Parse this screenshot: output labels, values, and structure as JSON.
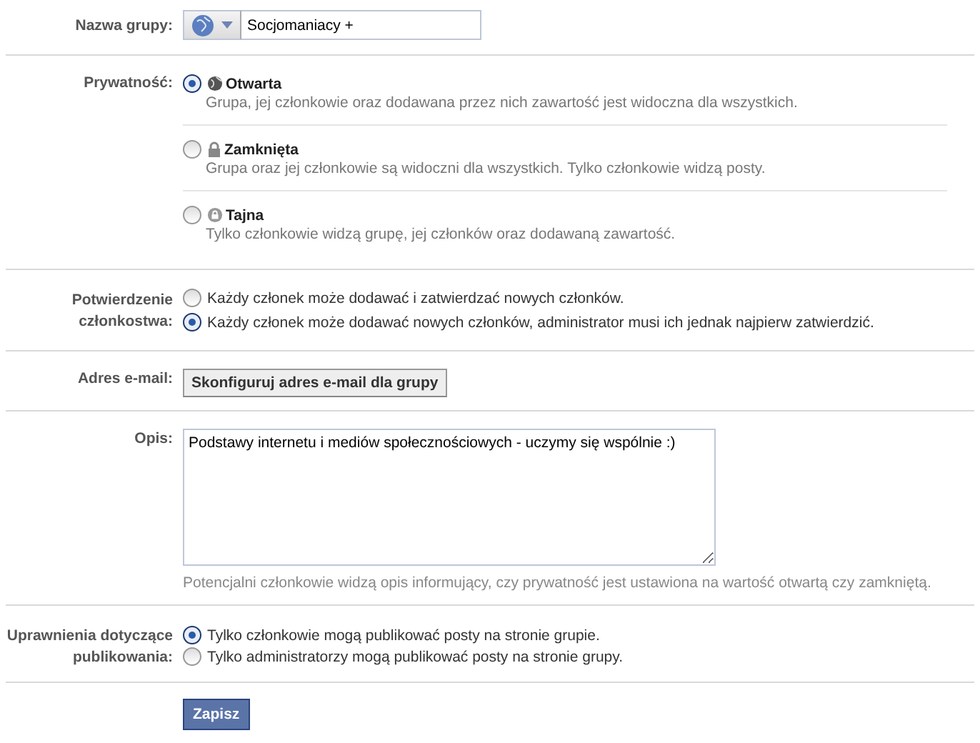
{
  "group_name": {
    "label": "Nazwa grupy:",
    "value": "Socjomaniacy +"
  },
  "privacy": {
    "label": "Prywatność:",
    "options": [
      {
        "kind": "open",
        "title": "Otwarta",
        "description": "Grupa, jej członkowie oraz dodawana przez nich zawartość jest widoczna dla wszystkich.",
        "selected": true
      },
      {
        "kind": "closed",
        "title": "Zamknięta",
        "description": "Grupa oraz jej członkowie są widoczni dla wszystkich. Tylko członkowie widzą posty.",
        "selected": false
      },
      {
        "kind": "secret",
        "title": "Tajna",
        "description": "Tylko członkowie widzą grupę, jej członków oraz dodawaną zawartość.",
        "selected": false
      }
    ]
  },
  "membership": {
    "label_lines": [
      "Potwierdzenie",
      "członkostwa:"
    ],
    "options": [
      {
        "label": "Każdy członek może dodawać i zatwierdzać nowych członków.",
        "selected": false
      },
      {
        "label": "Każdy członek może dodawać nowych członków, administrator musi ich jednak najpierw zatwierdzić.",
        "selected": true
      }
    ]
  },
  "email": {
    "label": "Adres e-mail:",
    "button": "Skonfiguruj adres e-mail dla grupy"
  },
  "description": {
    "label": "Opis:",
    "value": "Podstawy internetu i mediów społecznościowych - uczymy się wspólnie :)",
    "hint": "Potencjalni członkowie widzą opis informujący, czy prywatność jest ustawiona na wartość otwartą czy zamkniętą."
  },
  "posting": {
    "label_lines": [
      "Uprawnienia dotyczące",
      "publikowania:"
    ],
    "options": [
      {
        "label": "Tylko członkowie mogą publikować posty na stronie grupie.",
        "selected": true
      },
      {
        "label": "Tylko administratorzy mogą publikować posty na stronie grupy.",
        "selected": false
      }
    ]
  },
  "save_button": "Zapisz"
}
